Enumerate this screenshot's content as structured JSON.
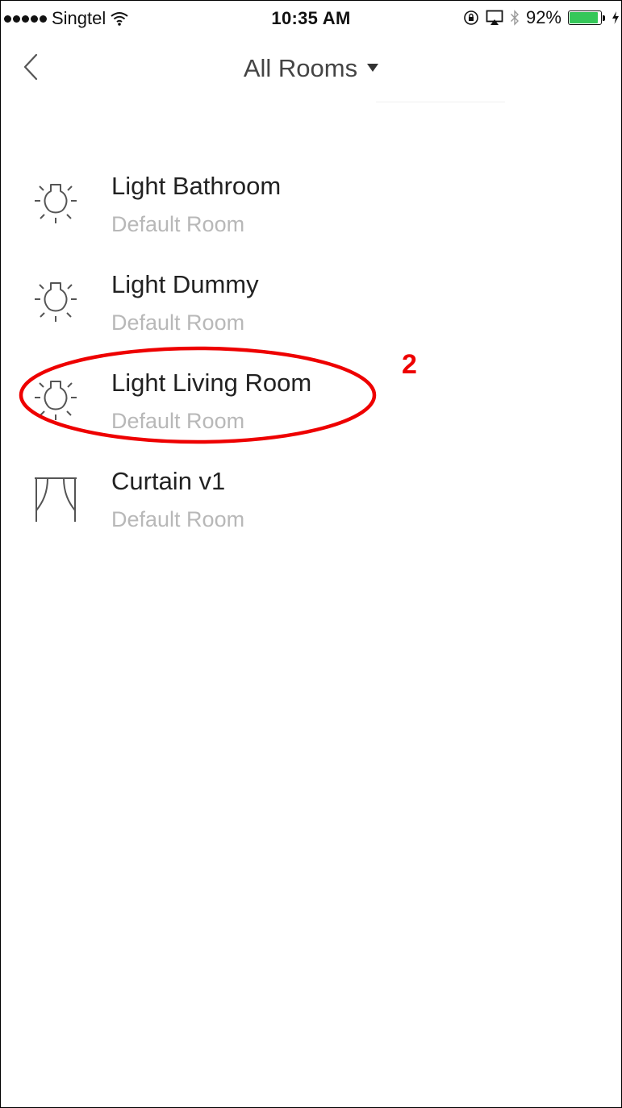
{
  "status_bar": {
    "carrier": "Singtel",
    "time": "10:35 AM",
    "battery_percent": "92%",
    "battery_level": 0.92,
    "battery_color": "#35c759",
    "icons": [
      "signal-dots-icon",
      "wifi-icon",
      "orientation-lock-icon",
      "airplay-icon",
      "bluetooth-icon",
      "battery-icon",
      "charging-icon"
    ]
  },
  "nav": {
    "back_icon": "chevron-left-icon",
    "title": "All Rooms",
    "dropdown_icon": "caret-down-icon"
  },
  "devices": [
    {
      "name": "Light Bathroom",
      "room": "Default Room",
      "icon": "light-bulb-icon"
    },
    {
      "name": "Light Dummy",
      "room": "Default Room",
      "icon": "light-bulb-icon"
    },
    {
      "name": "Light Living Room",
      "room": "Default Room",
      "icon": "light-bulb-icon"
    },
    {
      "name": "Curtain v1",
      "room": "Default Room",
      "icon": "curtain-icon"
    }
  ],
  "annotation": {
    "label": "2",
    "color": "#ee0000"
  }
}
